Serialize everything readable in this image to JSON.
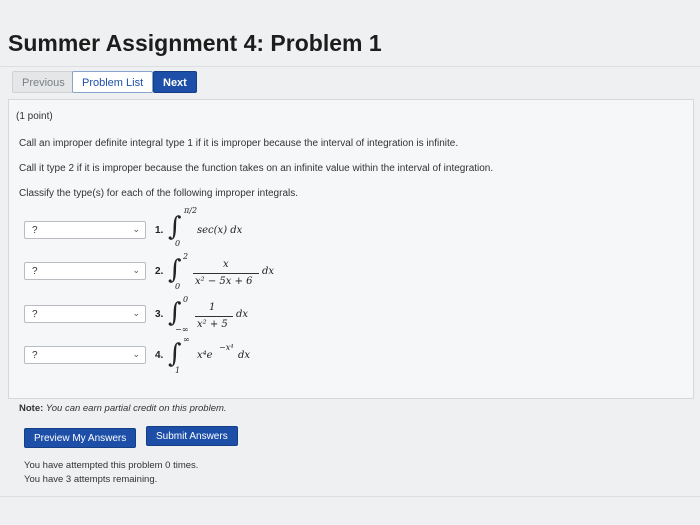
{
  "page": {
    "title": "Summer Assignment 4: Problem 1"
  },
  "nav": {
    "previous": "Previous",
    "problem_list": "Problem List",
    "next": "Next"
  },
  "problem": {
    "points": "(1 point)",
    "line1": "Call an improper definite integral type 1 if it is improper because the interval of integration is infinite.",
    "line2": "Call it type 2 if it is improper because the function takes on an infinite value within the interval of integration.",
    "line3": "Classify the type(s) for each of the following improper integrals.",
    "items": [
      {
        "select_value": "?",
        "number": "1.",
        "lower": "0",
        "upper": "π/2",
        "integrand": "sec(x) dx"
      },
      {
        "select_value": "?",
        "number": "2.",
        "lower": "0",
        "upper": "2",
        "numerator": "x",
        "denominator": "x² − 5x + 6",
        "dx": "dx"
      },
      {
        "select_value": "?",
        "number": "3.",
        "lower": "−∞",
        "upper": "0",
        "numerator": "1",
        "denominator": "x² + 5",
        "dx": "dx"
      },
      {
        "select_value": "?",
        "number": "4.",
        "lower": "1",
        "upper": "∞",
        "integrand": "x⁴e",
        "exponent": "−x⁴",
        "dx": "dx"
      }
    ],
    "chevron": "⌄"
  },
  "note": {
    "label": "Note:",
    "text": "You can earn partial credit on this problem."
  },
  "actions": {
    "preview": "Preview My Answers",
    "submit": "Submit Answers"
  },
  "attempts": {
    "line1": "You have attempted this problem 0 times.",
    "line2": "You have 3 attempts remaining."
  }
}
